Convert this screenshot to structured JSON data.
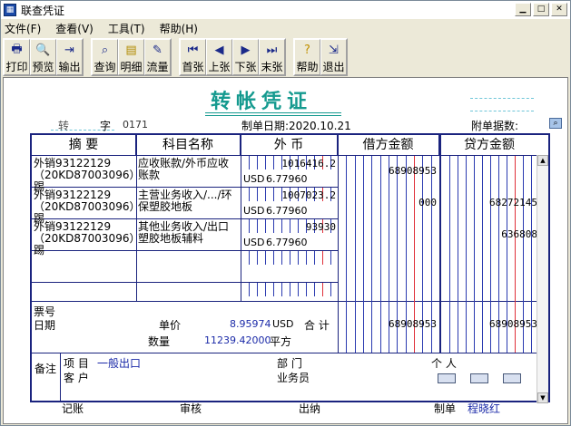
{
  "window": {
    "title": "联查凭证",
    "btn_min": "▁",
    "btn_max": "□",
    "btn_close": "✕"
  },
  "menu": {
    "file": "文件(F)",
    "view": "查看(V)",
    "tools": "工具(T)",
    "help": "帮助(H)"
  },
  "toolbar": {
    "print": "打印",
    "preview": "预览",
    "export": "输出",
    "query": "查询",
    "detail": "明细",
    "flow": "流量",
    "first": "首张",
    "prev": "上张",
    "next": "下张",
    "last": "末张",
    "help": "帮助",
    "exit": "退出"
  },
  "voucher": {
    "title": "转帐凭证",
    "type": "转",
    "zi": "字",
    "number": "0171",
    "date_label": "制单日期:",
    "date": "2020.10.21",
    "attach_label": "附单据数:"
  },
  "columns": {
    "summary": "摘 要",
    "account": "科目名称",
    "foreign": "外 币",
    "debit": "借方金额",
    "credit": "贷方金额"
  },
  "entries": [
    {
      "summary": "外销93122129（20KD87003096）踢",
      "account": "应收账款/外币应收账款",
      "foreign_amount": "1016416.2",
      "currency": "USD",
      "rate": "6.77960",
      "debit": "68908953",
      "credit": ""
    },
    {
      "summary": "外销93122129（20KD87003096）踢",
      "account": "主营业务收入/.../环保塑胶地板",
      "foreign_amount": "1007023.2",
      "currency": "USD",
      "rate": "6.77960",
      "debit": "000",
      "credit": "68272145"
    },
    {
      "summary": "外销93122129（20KD87003096）踢",
      "account": "其他业务收入/出口塑胶地板辅料",
      "foreign_amount": "93930",
      "currency": "USD",
      "rate": "6.77960",
      "debit": "",
      "credit": "636808"
    }
  ],
  "info": {
    "ticket_label": "票号",
    "date_label": "日期",
    "price_label": "单价",
    "price": "8.95974",
    "price_unit": "USD",
    "qty_label": "数量",
    "qty": "11239.42000",
    "qty_unit": "平方",
    "total_label": "合 计",
    "total_debit": "68908953",
    "total_credit": "68908953"
  },
  "remarks": {
    "label": "备注",
    "project_label": "项  目",
    "project_value": "一般出口",
    "dept_label": "部  门",
    "person_label": "个  人",
    "customer_label": "客  户",
    "salesman_label": "业务员"
  },
  "footer": {
    "bookkeep": "记账",
    "audit": "审核",
    "cashier": "出纳",
    "maker_label": "制单",
    "maker": "程晓红"
  }
}
